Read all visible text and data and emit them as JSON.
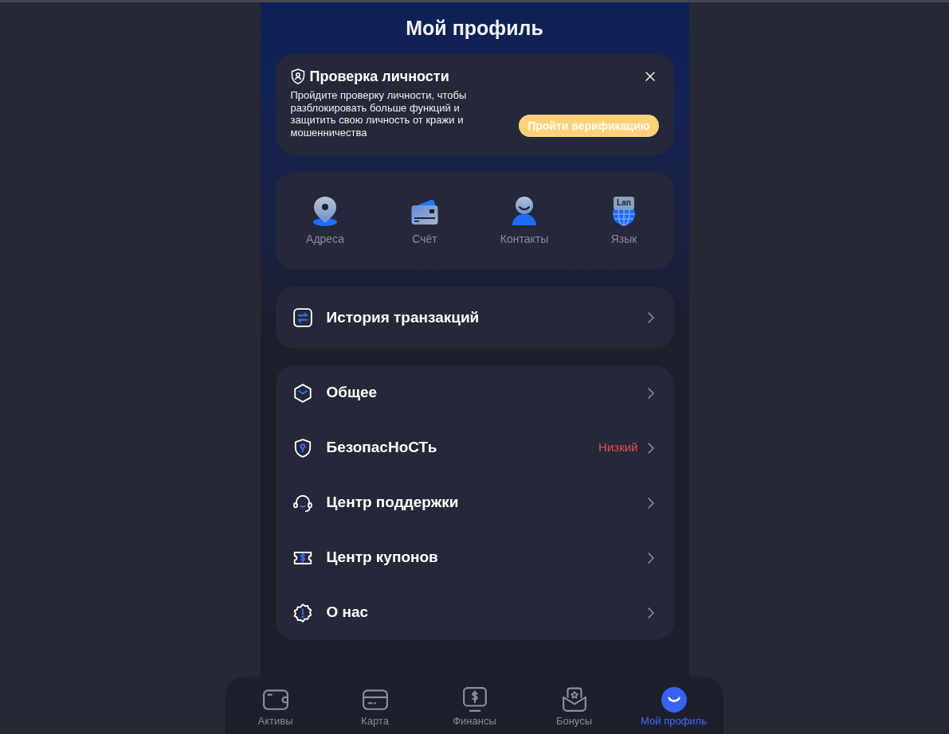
{
  "header": {
    "title": "Мой профиль"
  },
  "verification": {
    "title": "Проверка личности",
    "text": "Пройдите проверку личности, чтобы разблокировать больше функций и защитить свою личность от кражи и мошенничества",
    "button": "Пройти верификацию"
  },
  "shortcuts": [
    {
      "kind": "address",
      "label": "Адреса"
    },
    {
      "kind": "account",
      "label": "Счёт"
    },
    {
      "kind": "contacts",
      "label": "Контакты"
    },
    {
      "kind": "language",
      "label": "Язык",
      "badge": "Lan"
    }
  ],
  "transactions": {
    "label": "История транзакций"
  },
  "settings": [
    {
      "kind": "general",
      "label": "Общее"
    },
    {
      "kind": "security",
      "label": "БезопасНоСТь",
      "status": "Низкий"
    },
    {
      "kind": "support",
      "label": "Центр поддержки"
    },
    {
      "kind": "coupons",
      "label": "Центр купонов"
    },
    {
      "kind": "about",
      "label": "О нас"
    }
  ],
  "nav": [
    {
      "kind": "assets",
      "label": "Активы",
      "selected": false
    },
    {
      "kind": "card",
      "label": "Карта",
      "selected": false
    },
    {
      "kind": "finance",
      "label": "Финансы",
      "selected": false
    },
    {
      "kind": "bonus",
      "label": "Бонусы",
      "selected": false
    },
    {
      "kind": "profile",
      "label": "Мой профиль",
      "selected": true
    }
  ]
}
